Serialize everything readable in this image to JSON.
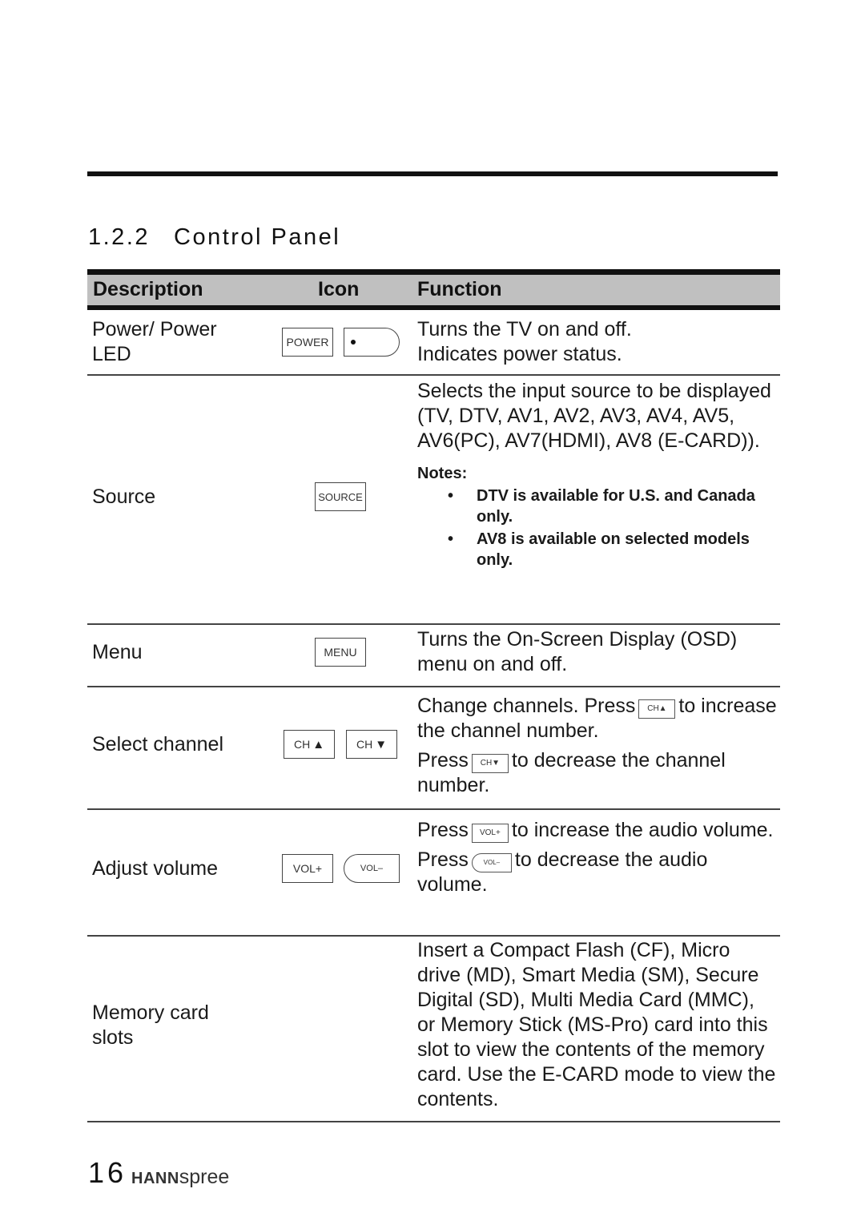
{
  "section": {
    "number": "1.2.2",
    "title": "Control Panel"
  },
  "table": {
    "headers": {
      "description": "Description",
      "icon": "Icon",
      "function": "Function"
    },
    "rows": [
      {
        "description": "Power/ Power LED",
        "icons": [
          "POWER",
          "power-led"
        ],
        "function": [
          "Turns the TV on and off.",
          "Indicates power status."
        ]
      },
      {
        "description": "Source",
        "icons": [
          "SOURCE"
        ],
        "function": "Selects the input source to be displayed (TV, DTV, AV1, AV2, AV3, AV4, AV5, AV6(PC), AV7(HDMI), AV8 (E-CARD)).",
        "notes_title": "Notes:",
        "notes": [
          "DTV is available for U.S. and Canada only.",
          "AV8 is available on selected models only."
        ]
      },
      {
        "description": "Menu",
        "icons": [
          "MENU"
        ],
        "function": "Turns the On-Screen Display (OSD) menu on and off."
      },
      {
        "description": "Select channel",
        "icons": [
          "CH",
          "CH"
        ],
        "icon_glyphs": [
          "▲",
          "▼"
        ],
        "function": {
          "line1_a": "Change channels. Press",
          "line1_b": "to increase the channel number.",
          "line2_a": "Press",
          "line2_b": "to decrease the channel number."
        }
      },
      {
        "description": "Adjust volume",
        "icons": [
          "VOL+",
          "VOL–"
        ],
        "function": {
          "line1_a": "Press",
          "line1_b": "to increase the audio volume.",
          "line2_a": "Press",
          "line2_b": "to decrease the audio volume."
        }
      },
      {
        "description": "Memory card slots",
        "icons": [],
        "function": "Insert a Compact Flash (CF), Micro drive (MD), Smart Media (SM), Secure Digital (SD), Multi Media Card (MMC), or Memory Stick (MS-Pro) card into this slot to view the contents of the memory card. Use the E-CARD mode to view the contents."
      }
    ]
  },
  "footer": {
    "page_number": "16",
    "brand_bold": "HANN",
    "brand_light": "spree"
  }
}
